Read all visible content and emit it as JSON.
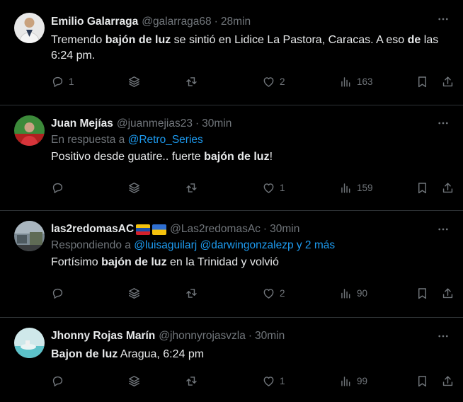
{
  "tweets": [
    {
      "name": "Emilio Galarraga",
      "handle": "@galarraga68",
      "sep": "·",
      "time": "28min",
      "text_parts": [
        "Tremendo ",
        "bajón de luz",
        " se sintió en Lidice La Pastora, Caracas. A eso ",
        "de",
        " las 6:24 pm."
      ],
      "replies": "1",
      "likes": "2",
      "views": "163"
    },
    {
      "name": "Juan Mejías",
      "handle": "@juanmejias23",
      "sep": "·",
      "time": "30min",
      "reply_prefix": "En respuesta a ",
      "reply_to": "@Retro_Series",
      "text_parts": [
        "Positivo desde guatire.. fuerte ",
        "bajón de luz",
        "!"
      ],
      "replies": "",
      "likes": "1",
      "views": "159"
    },
    {
      "name": "las2redomasAC",
      "handle": "@Las2redomasAc",
      "sep": "·",
      "time": "30min",
      "reply_prefix": "Respondiendo a ",
      "reply_to_1": "@luisaguilarj",
      "reply_to_2": "@darwingonzalezp",
      "reply_more": "y 2 más",
      "text_parts": [
        "Fortísimo ",
        "bajón de luz",
        " en la Trinidad y volvió"
      ],
      "replies": "",
      "likes": "2",
      "views": "90"
    },
    {
      "name": "Jhonny Rojas Marín",
      "handle": "@jhonnyrojasvzla",
      "sep": "·",
      "time": "30min",
      "text_parts": [
        "Bajon de luz",
        " Aragua, 6:24 pm"
      ],
      "replies": "",
      "likes": "1",
      "views": "99"
    }
  ],
  "colors": {
    "background": "#000000",
    "text": "#e7e9ea",
    "muted": "#71767b",
    "link": "#1d9bf0",
    "divider": "#2f3336"
  },
  "icons": {
    "reply": "reply-icon",
    "grok": "grok-stack-icon",
    "retweet": "retweet-icon",
    "like": "heart-icon",
    "views": "views-chart-icon",
    "bookmark": "bookmark-icon",
    "share": "share-icon",
    "more": "more-dots-icon"
  }
}
